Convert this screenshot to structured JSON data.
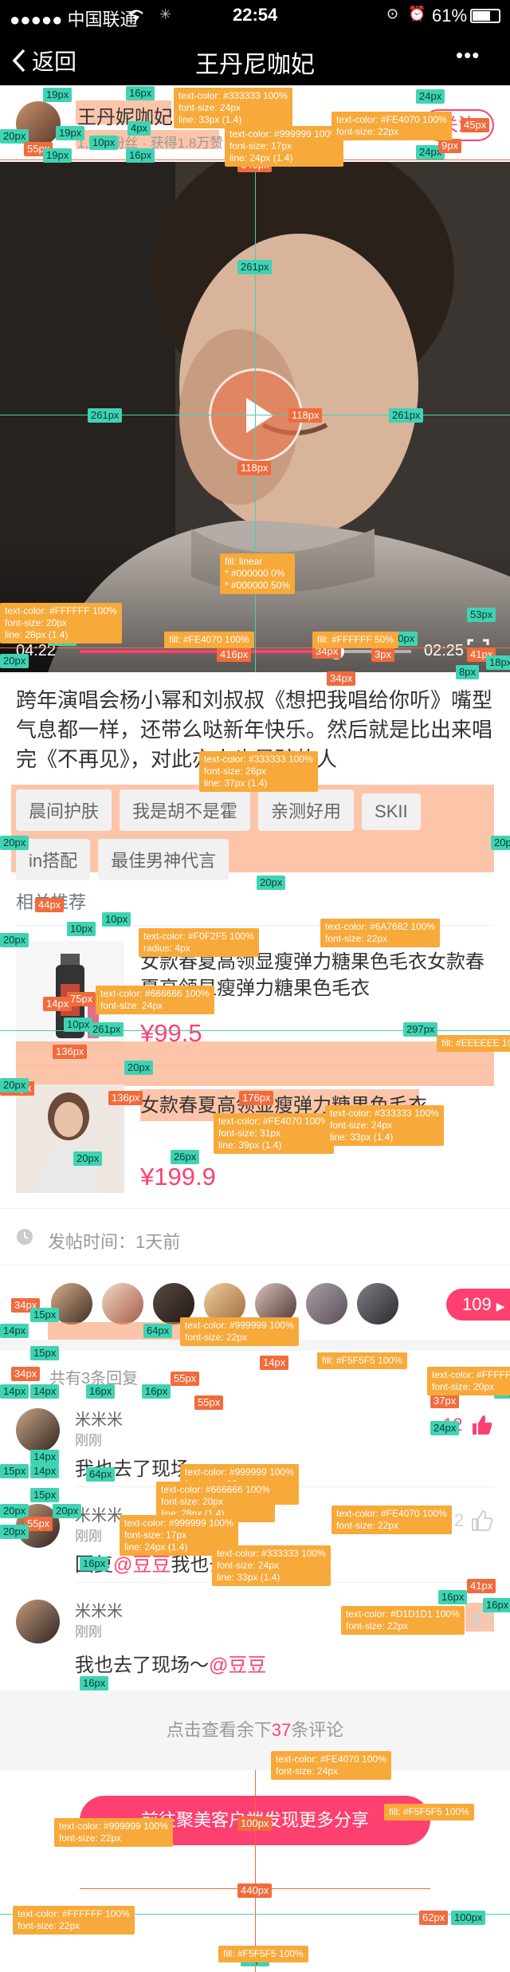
{
  "status": {
    "carrier": "●●●●● 中国联通",
    "time": "22:54",
    "battery": "61%"
  },
  "nav": {
    "back_label": "返回",
    "title": "王丹尼咖妃",
    "more": "•••"
  },
  "author": {
    "name": "王丹妮咖妃",
    "stats": "1,221粉丝 · 获得1.8万赞",
    "follow_label": "关注"
  },
  "video": {
    "current_time": "04:22",
    "duration": "02:25"
  },
  "post": {
    "text": "跨年演唱会杨小幂和刘叔叔《想把我唱给你听》嘴型气息都一样，还带么哒新年快乐。然后就是比出来唱完《不再见》，对此亦人也是醉的人"
  },
  "tags": [
    "晨间护肤",
    "我是胡不是霍",
    "亲测好用",
    "SKII",
    "in搭配",
    "最佳男神代言"
  ],
  "related": {
    "heading": "相关推荐",
    "products": [
      {
        "name": "女款春夏高领显瘦弹力糖果色毛衣女款春夏高领显瘦弹力糖果色毛衣",
        "price": "¥99.5"
      },
      {
        "name": "女款春夏高领显瘦弹力糖果色毛衣",
        "price": "¥199.9"
      }
    ]
  },
  "post_time": "发帖时间：1天前",
  "likes": {
    "count": "109"
  },
  "comments": {
    "summary": "共有3条回复",
    "items": [
      {
        "user": "米米米",
        "time": "刚刚",
        "text": "我也去了现场",
        "likes": "12"
      },
      {
        "user": "米米米",
        "time": "刚刚",
        "text_prefix": "回复",
        "mention": "@豆豆",
        "text_suffix": "我也去了现场",
        "likes": "2"
      },
      {
        "user": "米米米",
        "time": "刚刚",
        "text_prefix": "我也去了现场～",
        "mention": "@豆豆",
        "likes": ""
      }
    ],
    "more_prefix": "点击查看余下",
    "more_count": "37",
    "more_suffix": "条评论"
  },
  "cta": {
    "label": "前往聚美客户端发现更多分享"
  },
  "annotations": {
    "spacing": [
      "19px",
      "16px",
      "24px",
      "20px",
      "4px",
      "19px",
      "55px",
      "19px",
      "10px",
      "16px",
      "24px",
      "45px",
      "9px",
      "640px",
      "261px",
      "261px",
      "118px",
      "261px",
      "118px",
      "60px",
      "10px",
      "53px",
      "416px",
      "34px",
      "10px",
      "3px",
      "20px",
      "41px",
      "18px",
      "8px",
      "20px",
      "34px",
      "20px",
      "20px",
      "20px",
      "10px",
      "10px",
      "44px",
      "20px",
      "297px",
      "75px",
      "14px",
      "10px",
      "261px",
      "136px",
      "20px",
      "138px",
      "136px",
      "20px",
      "26px",
      "176px",
      "20px",
      "34px",
      "14px",
      "15px",
      "64px",
      "15px",
      "14px",
      "34px",
      "14px",
      "55px",
      "16px",
      "55px",
      "16px",
      "14px",
      "37px",
      "14px",
      "24px",
      "14px",
      "15px",
      "64px",
      "14px",
      "20px",
      "20px",
      "55px",
      "15px",
      "20px",
      "16px",
      "41px",
      "16px",
      "16px",
      "16px",
      "100px",
      "440px",
      "100px",
      "100px",
      "62px",
      "100px",
      "38px"
    ],
    "notes": [
      "text-color: #333333 100%\nfont-size: 24px\nline: 33px (1.4)",
      "text-color: #999999 100%\nfont-size: 17px\nline: 24px (1.4)",
      "text-color: #FE4070 100%\nfont-size: 22px",
      "fill: linear\n* #000000 0%\n* #000000 50%",
      "text-color: #FFFFFF 100%\nfont-size: 20px\nline: 28px (1.4)",
      "fill: #FE4070 100%",
      "fill: #FFFFFF 50%",
      "text-color: #333333 100%\nfont-size: 26px\nline: 37px (1.4)",
      "text-color: #F0F2F5 100%\nradius: 4px",
      "text-color: #6A7682 100%\nfont-size: 22px",
      "text-color: #666666 100%\nfont-size: 24px",
      "fill: #EEEEEE 100%",
      "text-color: #FE4070 100%\nfont-size: 31px\nline: 39px (1.4)",
      "text-color: #333333 100%\nfont-size: 24px\nline: 33px (1.4)",
      "text-color: #999999 100%\nfont-size: 22px",
      "fill: #F5F5F5 100%",
      "text-color: #FFFFFF\nfont-size: 20px",
      "text-color: #999999 100%\nfont-size: 20px\nline: 28px (1.4)",
      "text-color: #666666 100%\nfont-size: 20px\nline: 28px (1.4)",
      "text-color: #999999 100%\nfont-size: 17px\nline: 24px (1.4)",
      "text-color: #333333 100%\nfont-size: 24px\nline: 33px (1.4)",
      "text-color: #FE4070 100%\nfont-size: 22px",
      "text-color: #D1D1D1 100%\nfont-size: 22px",
      "text-color: #FE4070 100%\nfont-size: 24px",
      "text-color: #999999 100%\nfont-size: 22px",
      "fill: #F5F5F5 100%",
      "text-color: #FFFFFF 100%\nfont-size: 22px",
      "fill: #F5F5F5 100%"
    ]
  },
  "colors": {
    "accent": "#FE4070",
    "tagbg": "#F0F2F5"
  }
}
